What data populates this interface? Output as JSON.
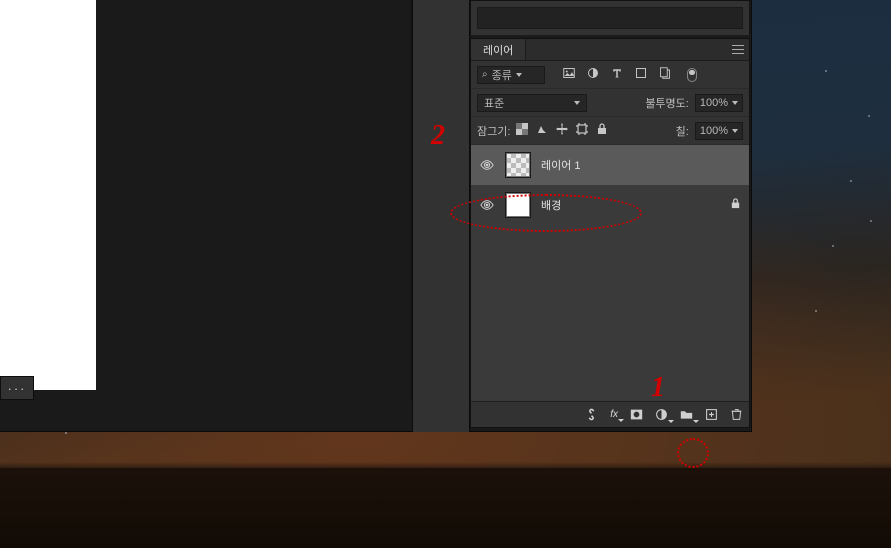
{
  "annotations": {
    "one": "1",
    "two": "2"
  },
  "panel": {
    "tab_label": "레이어",
    "filter_label": "종류",
    "blend_mode": "표준",
    "opacity_label": "불투명도:",
    "opacity_value": "100%",
    "lock_label": "잠그기:",
    "fill_label": "칠:",
    "fill_value": "100%",
    "layers": [
      {
        "name": "레이어  1",
        "locked": false,
        "selected": true,
        "thumb": "checker"
      },
      {
        "name": "배경",
        "locked": true,
        "selected": false,
        "thumb": "white"
      }
    ],
    "filter_icons": {
      "image": "image-filter-icon",
      "adjust": "adjustment-filter-icon",
      "type": "type-filter-icon",
      "shape": "shape-filter-icon",
      "smart": "smartobject-filter-icon"
    },
    "lock_icons": {
      "pixel": "lock-transparency-icon",
      "brush": "lock-image-icon",
      "move": "lock-position-icon",
      "artboard": "lock-artboard-icon",
      "all": "lock-all-icon"
    },
    "footer_icons": {
      "link": "link-layers-icon",
      "fx": "layer-style-icon",
      "mask": "add-mask-icon",
      "adjust": "new-adjustment-icon",
      "group": "new-group-icon",
      "new": "new-layer-icon",
      "trash": "delete-layer-icon"
    }
  },
  "dock": {
    "more": "···"
  }
}
